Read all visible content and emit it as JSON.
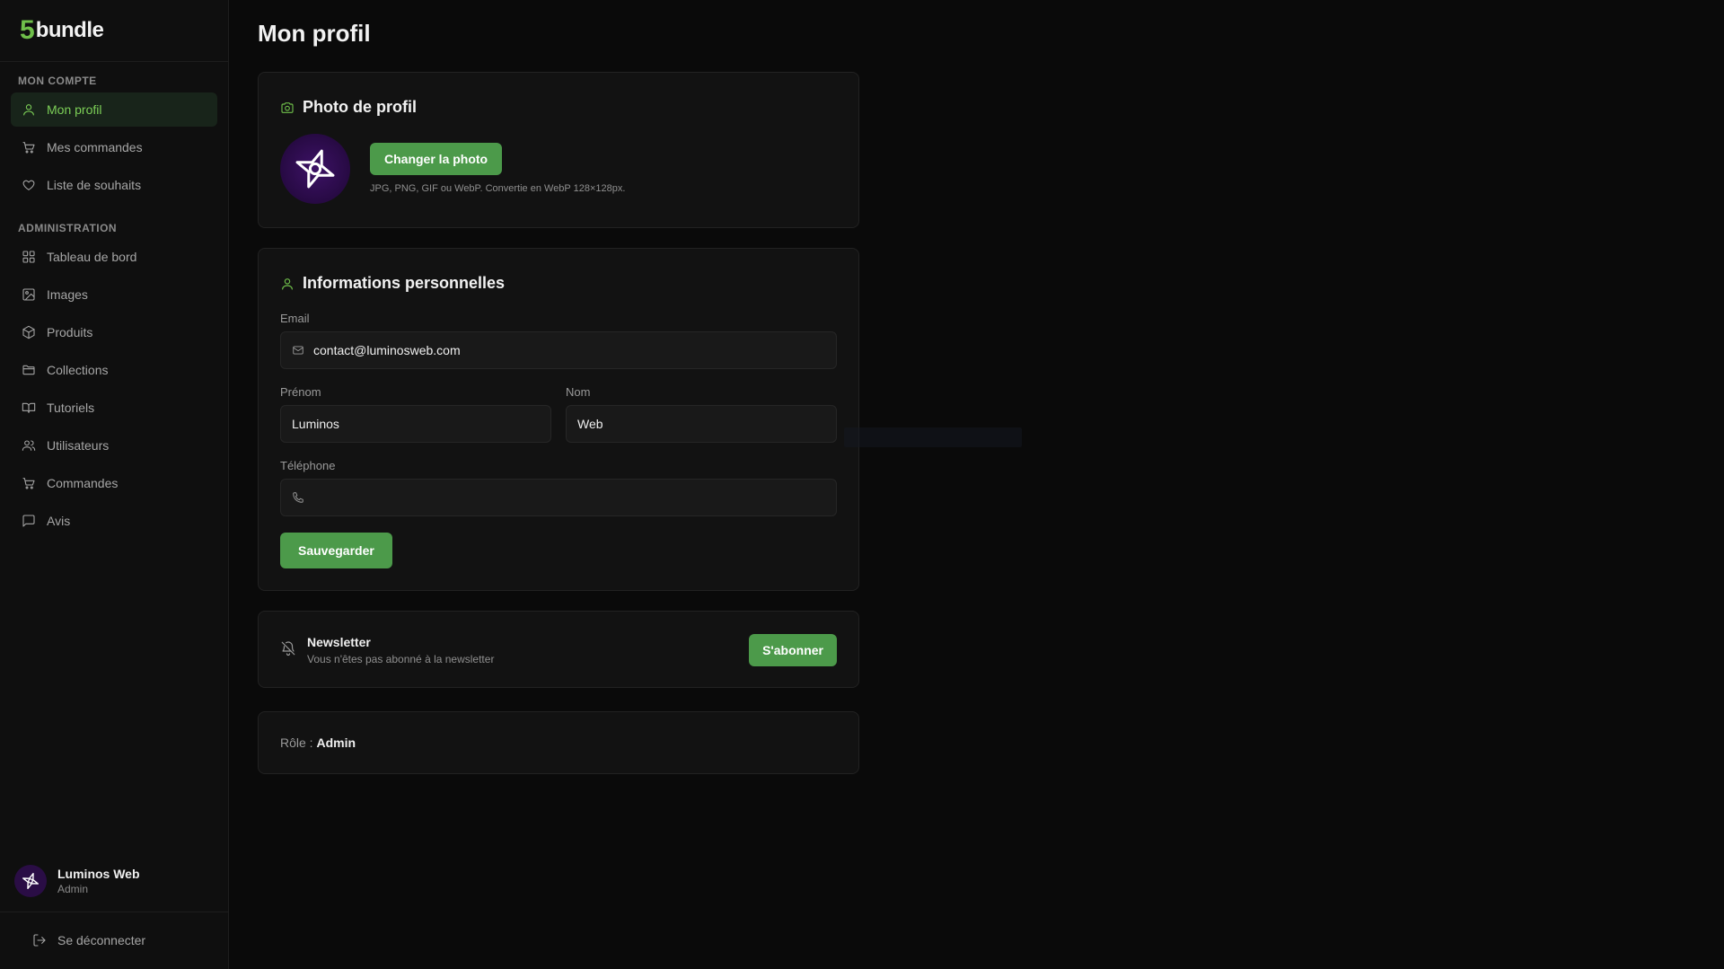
{
  "brand": {
    "number": "5",
    "name": "bundle"
  },
  "sidebar": {
    "account_label": "MON COMPTE",
    "account_items": [
      {
        "label": "Mon profil",
        "icon": "user-icon"
      },
      {
        "label": "Mes commandes",
        "icon": "cart-icon"
      },
      {
        "label": "Liste de souhaits",
        "icon": "heart-icon"
      }
    ],
    "admin_label": "ADMINISTRATION",
    "admin_items": [
      {
        "label": "Tableau de bord",
        "icon": "dashboard-icon"
      },
      {
        "label": "Images",
        "icon": "image-icon"
      },
      {
        "label": "Produits",
        "icon": "package-icon"
      },
      {
        "label": "Collections",
        "icon": "folder-icon"
      },
      {
        "label": "Tutoriels",
        "icon": "book-icon"
      },
      {
        "label": "Utilisateurs",
        "icon": "users-icon"
      },
      {
        "label": "Commandes",
        "icon": "cart-icon"
      },
      {
        "label": "Avis",
        "icon": "message-icon"
      }
    ],
    "user": {
      "name": "Luminos Web",
      "role": "Admin"
    },
    "logout_label": "Se déconnecter"
  },
  "page": {
    "title": "Mon profil"
  },
  "photo": {
    "title": "Photo de profil",
    "button": "Changer la photo",
    "hint": "JPG, PNG, GIF ou WebP. Convertie en WebP 128×128px."
  },
  "info": {
    "title": "Informations personnelles",
    "email_label": "Email",
    "email_value": "contact@luminosweb.com",
    "firstname_label": "Prénom",
    "firstname_value": "Luminos",
    "lastname_label": "Nom",
    "lastname_value": "Web",
    "phone_label": "Téléphone",
    "phone_value": "",
    "save_button": "Sauvegarder"
  },
  "newsletter": {
    "title": "Newsletter",
    "subtitle": "Vous n'êtes pas abonné à la newsletter",
    "button": "S'abonner"
  },
  "role": {
    "label": "Rôle :",
    "value": "Admin"
  },
  "colors": {
    "accent": "#4c9a4a",
    "accent_text": "#7ccf57",
    "background": "#0a0a0a",
    "avatar": "#2a0b48"
  }
}
